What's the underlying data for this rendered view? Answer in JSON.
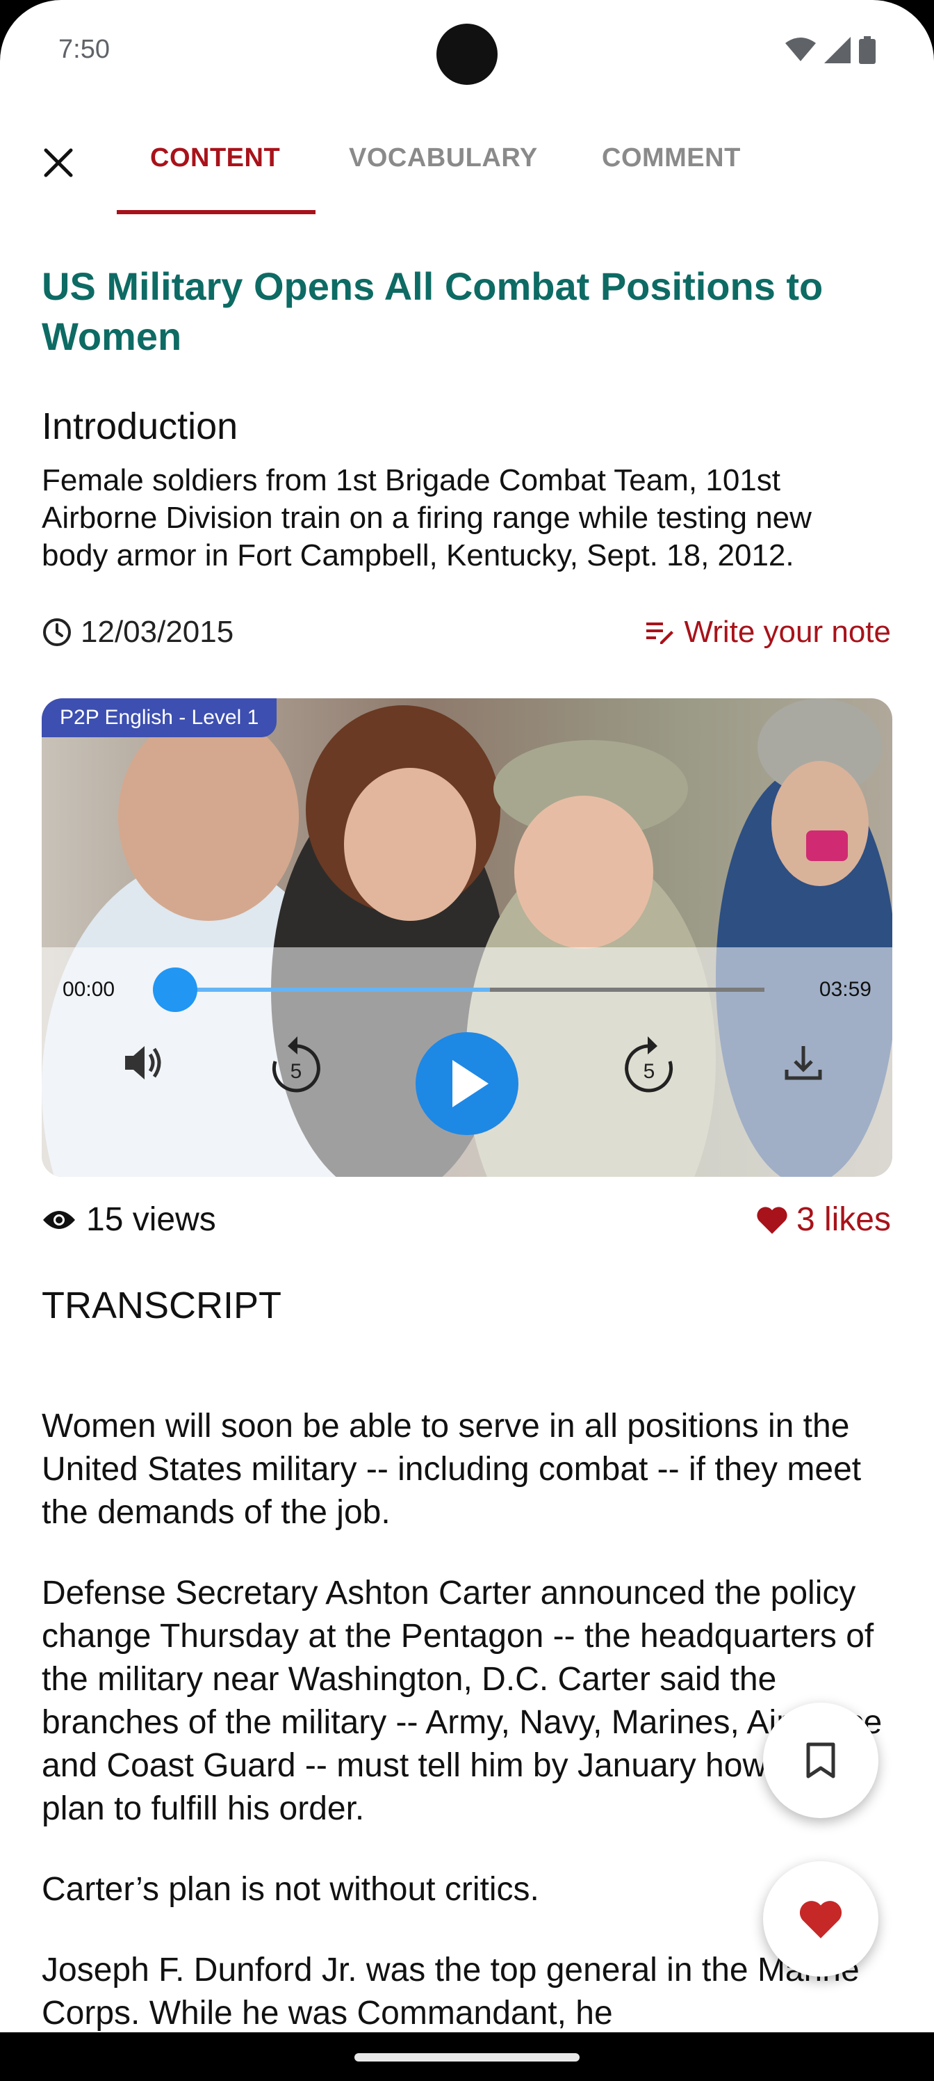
{
  "status_bar": {
    "time": "7:50"
  },
  "tabs": {
    "content": "CONTENT",
    "vocabulary": "VOCABULARY",
    "comment": "COMMENT",
    "active": "CONTENT"
  },
  "article": {
    "title": "US Military Opens All Combat Positions to Women",
    "intro_heading": "Introduction",
    "intro_text": "Female soldiers from 1st Brigade Combat Team, 101st Airborne Division train on a firing range while testing new body armor in Fort Campbell, Kentucky, Sept. 18, 2012.",
    "date": "12/03/2015",
    "note_label": "Write your note"
  },
  "player": {
    "badge": "P2P English - Level 1",
    "time_current": "00:00",
    "time_total": "03:59",
    "progress": 0.0,
    "buffered": 0.54,
    "rewind_seconds": "5",
    "forward_seconds": "5"
  },
  "stats": {
    "views": "15 views",
    "likes": "3 likes"
  },
  "transcript": {
    "heading": "TRANSCRIPT",
    "paragraphs": [
      "Women will soon be able to serve in all positions in the United States military -- including combat -- if they meet the demands of the job.",
      "Defense Secretary Ashton Carter announced the policy change Thursday at the Pentagon -- the headquarters of the military near Washington, D.C. Carter said the branches of the military -- Army, Navy, Marines, Air Force and Coast Guard -- must tell him by January how they plan to fulfill his order.",
      "Carter’s plan is not without critics.",
      "Joseph F. Dunford Jr. was the top general in the Marine Corps. While he was Commandant, he"
    ]
  },
  "colors": {
    "accent": "#a8121a",
    "title": "#0d6b64",
    "player_blue": "#1e88e5"
  }
}
